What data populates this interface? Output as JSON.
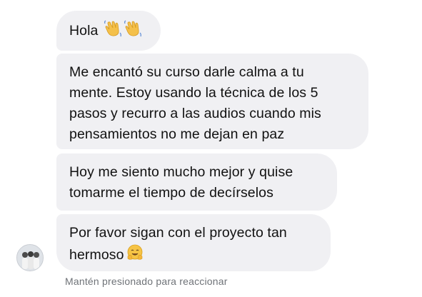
{
  "messages": [
    {
      "text": "Hola",
      "emojis": [
        "waving-hand",
        "waving-hand"
      ]
    },
    {
      "text": "Me encantó su curso darle calma a tu\nmente. Estoy usando la técnica de los 5\npasos y recurro a las audios cuando mis\npensamientos no me dejan en paz"
    },
    {
      "text": "Hoy me siento mucho mejor y quise\ntomarme el tiempo de decírselos"
    },
    {
      "text": "Por favor sigan con el proyecto tan\nhermoso",
      "emojis": [
        "hugging-face"
      ]
    }
  ],
  "hint": "Mantén presionado para reaccionar",
  "colors": {
    "bubble": "#f0f0f3",
    "text": "#111111",
    "hint": "#6f7378"
  }
}
